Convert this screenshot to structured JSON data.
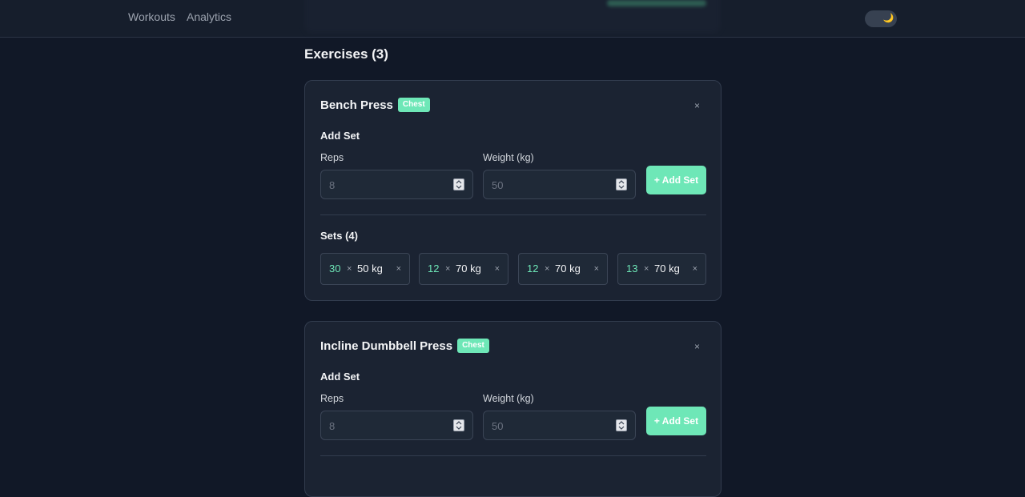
{
  "nav": {
    "links": [
      "Workouts",
      "Analytics"
    ],
    "theme_icon": "moon-icon",
    "theme_glyph": "🌙"
  },
  "section": {
    "title": "Exercises (3)"
  },
  "colors": {
    "accent": "#6ee7b7",
    "background": "#111827",
    "card": "#1b2332"
  },
  "exercises": [
    {
      "name": "Bench Press",
      "badge": "Chest",
      "remove_label": "×",
      "add_set_title": "Add Set",
      "reps_label": "Reps",
      "weight_label": "Weight (kg)",
      "reps_placeholder": "8",
      "weight_placeholder": "50",
      "add_button": "+ Add Set",
      "sets_title": "Sets (4)",
      "sets": [
        {
          "reps": "30",
          "times": "×",
          "weight": "50 kg",
          "remove": "×"
        },
        {
          "reps": "12",
          "times": "×",
          "weight": "70 kg",
          "remove": "×"
        },
        {
          "reps": "12",
          "times": "×",
          "weight": "70 kg",
          "remove": "×"
        },
        {
          "reps": "13",
          "times": "×",
          "weight": "70 kg",
          "remove": "×"
        }
      ]
    },
    {
      "name": "Incline Dumbbell Press",
      "badge": "Chest",
      "remove_label": "×",
      "add_set_title": "Add Set",
      "reps_label": "Reps",
      "weight_label": "Weight (kg)",
      "reps_placeholder": "8",
      "weight_placeholder": "50",
      "add_button": "+ Add Set"
    }
  ]
}
